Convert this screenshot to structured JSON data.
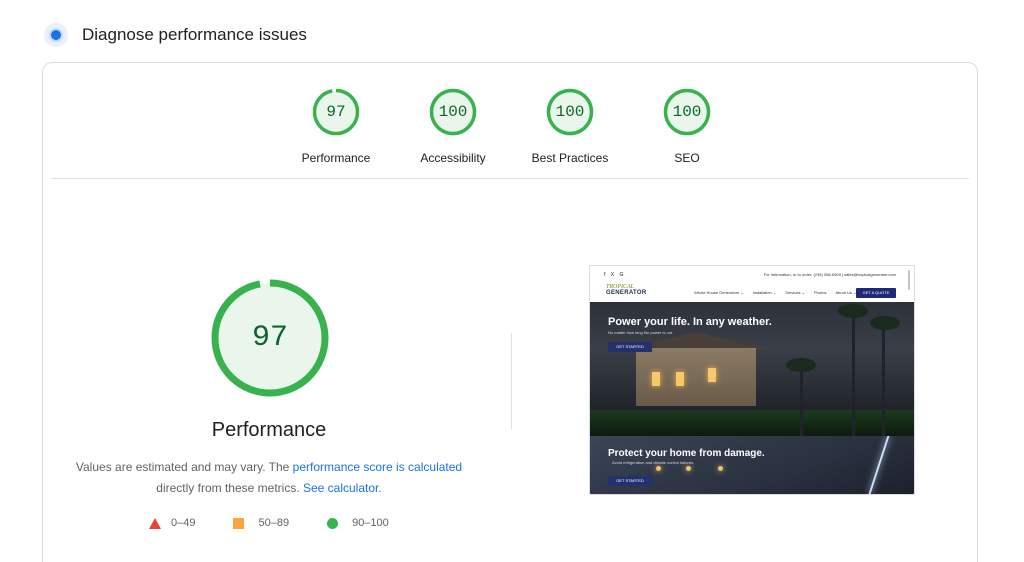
{
  "header": {
    "title": "Diagnose performance issues",
    "icon": "lighthouse-icon"
  },
  "colors": {
    "pass": "#37b24d",
    "pass_text": "#0d652d",
    "average": "#fba33f",
    "fail": "#ea4335",
    "link": "#1a73e8"
  },
  "gauges": [
    {
      "label": "Performance",
      "score": "97",
      "value": 97
    },
    {
      "label": "Accessibility",
      "score": "100",
      "value": 100
    },
    {
      "label": "Best Practices",
      "score": "100",
      "value": 100
    },
    {
      "label": "SEO",
      "score": "100",
      "value": 100
    }
  ],
  "main_gauge": {
    "score": "97",
    "value": 97,
    "title": "Performance"
  },
  "description": {
    "text_before": "Values are estimated and may vary. The ",
    "link1": "performance score is calculated",
    "text_middle": " directly from these metrics. ",
    "link2": "See calculator."
  },
  "legend": [
    {
      "shape": "triangle",
      "range": "0–49"
    },
    {
      "shape": "square",
      "range": "50–89"
    },
    {
      "shape": "circle",
      "range": "90–100"
    }
  ],
  "screenshot": {
    "social": "f  X  G",
    "contact": "For information, or to order: (239) 558-6509 | sales@tropicalgenerator.com",
    "logo_top": "TROPICAL",
    "logo_bottom": "GENERATOR",
    "nav": [
      "Whole House Generators ⌄",
      "Installation ⌄",
      "Services ⌄",
      "Photos",
      "About Us ⌄"
    ],
    "quote_btn": "GET A QUOTE",
    "hero1_title": "Power your life. In any weather.",
    "hero1_sub": "No matter how long the power is out.",
    "hero1_btn": "GET STARTED",
    "hero2_title": "Protect your home from damage.",
    "hero2_sub": "Avoid refrigeration and climate control failures.",
    "hero2_btn": "GET STARTED"
  }
}
